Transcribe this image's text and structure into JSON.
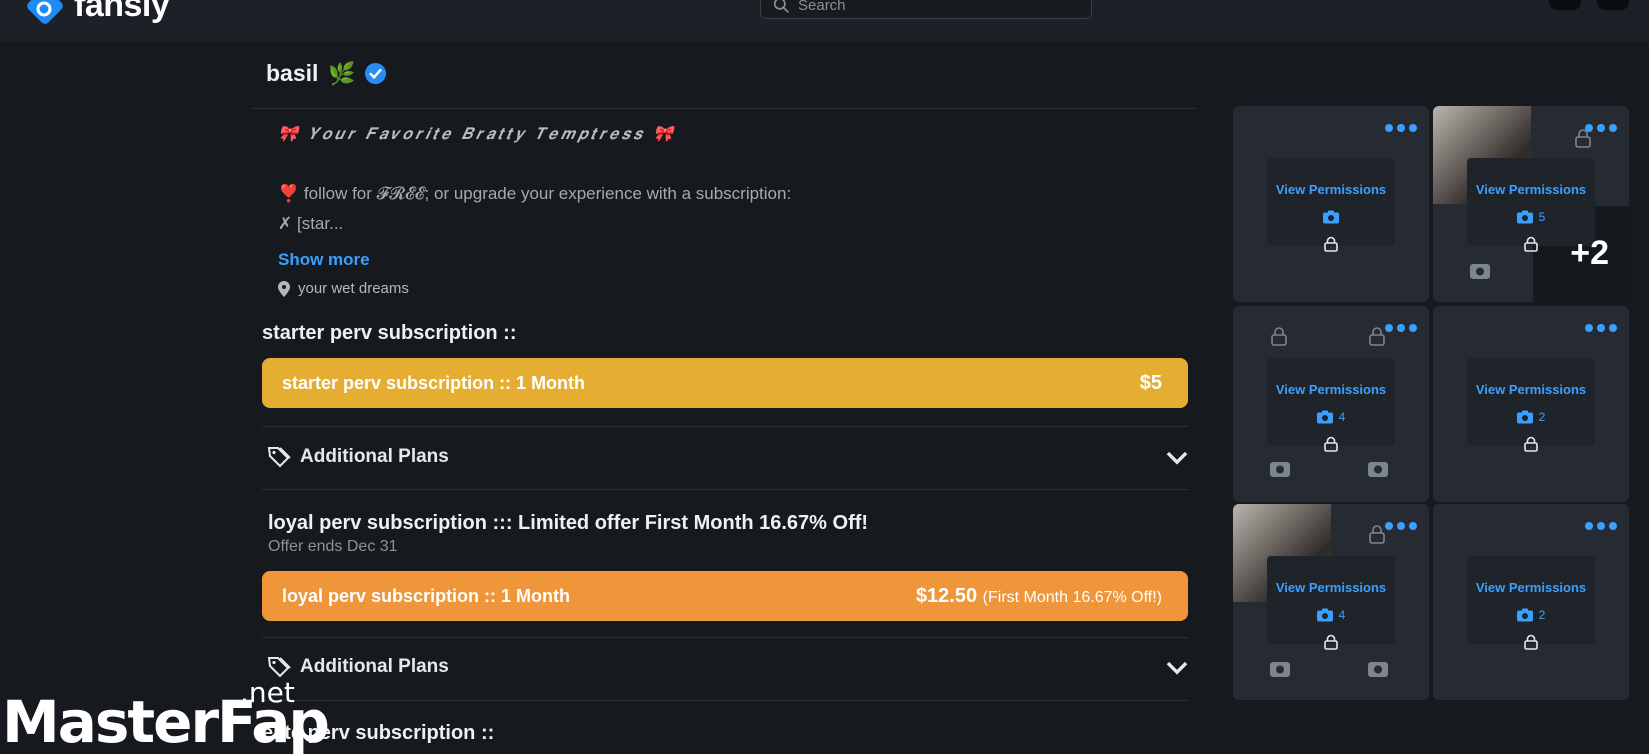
{
  "topbar": {
    "logo_text": "fansly",
    "search_placeholder": "Search"
  },
  "profile": {
    "name": "basil",
    "name_emoji": "🌿",
    "verified": true
  },
  "bio": {
    "tagline": "🎀 𝒀𝒐𝒖𝒓 𝑭𝒂𝒗𝒐𝒓𝒊𝒕𝒆 𝑩𝒓𝒂𝒕𝒕𝒚 𝑻𝒆𝒎𝒑𝒕𝒓𝒆𝒔𝒔 🎀",
    "follow_line": "❣️ follow for 𝓕𝓡𝓔𝓔; or upgrade your experience with a subscription:",
    "truncated_line": "✗ [star...",
    "show_more": "Show more",
    "location": "your wet dreams"
  },
  "subscriptions": [
    {
      "title": "starter perv subscription ::",
      "plan_label": "starter perv subscription :: 1 Month",
      "price": "$5",
      "price_note": "",
      "color": "#e5ae32",
      "additional_plans": "Additional Plans"
    },
    {
      "title": "loyal perv subscription ::: Limited offer First Month 16.67% Off!",
      "offer_ends": "Offer ends Dec 31",
      "plan_label": "loyal perv subscription :: 1 Month",
      "price": "$12.50",
      "price_note": "(First Month 16.67% Off!)",
      "color": "#ef963a",
      "additional_plans": "Additional Plans"
    },
    {
      "title": "elite perv subscription ::"
    }
  ],
  "media_grid": {
    "view_permissions": "View Permissions",
    "tiles": [
      {
        "count": ""
      },
      {
        "count": "5",
        "extra": "+2"
      },
      {
        "count": "4"
      },
      {
        "count": "2"
      },
      {
        "count": "4"
      },
      {
        "count": "2"
      }
    ]
  },
  "watermark": {
    "text_a": "Master",
    "text_b": "Fap",
    "text_c": ".net"
  },
  "colors": {
    "accent": "#3aa0ff",
    "background": "#16191e"
  }
}
